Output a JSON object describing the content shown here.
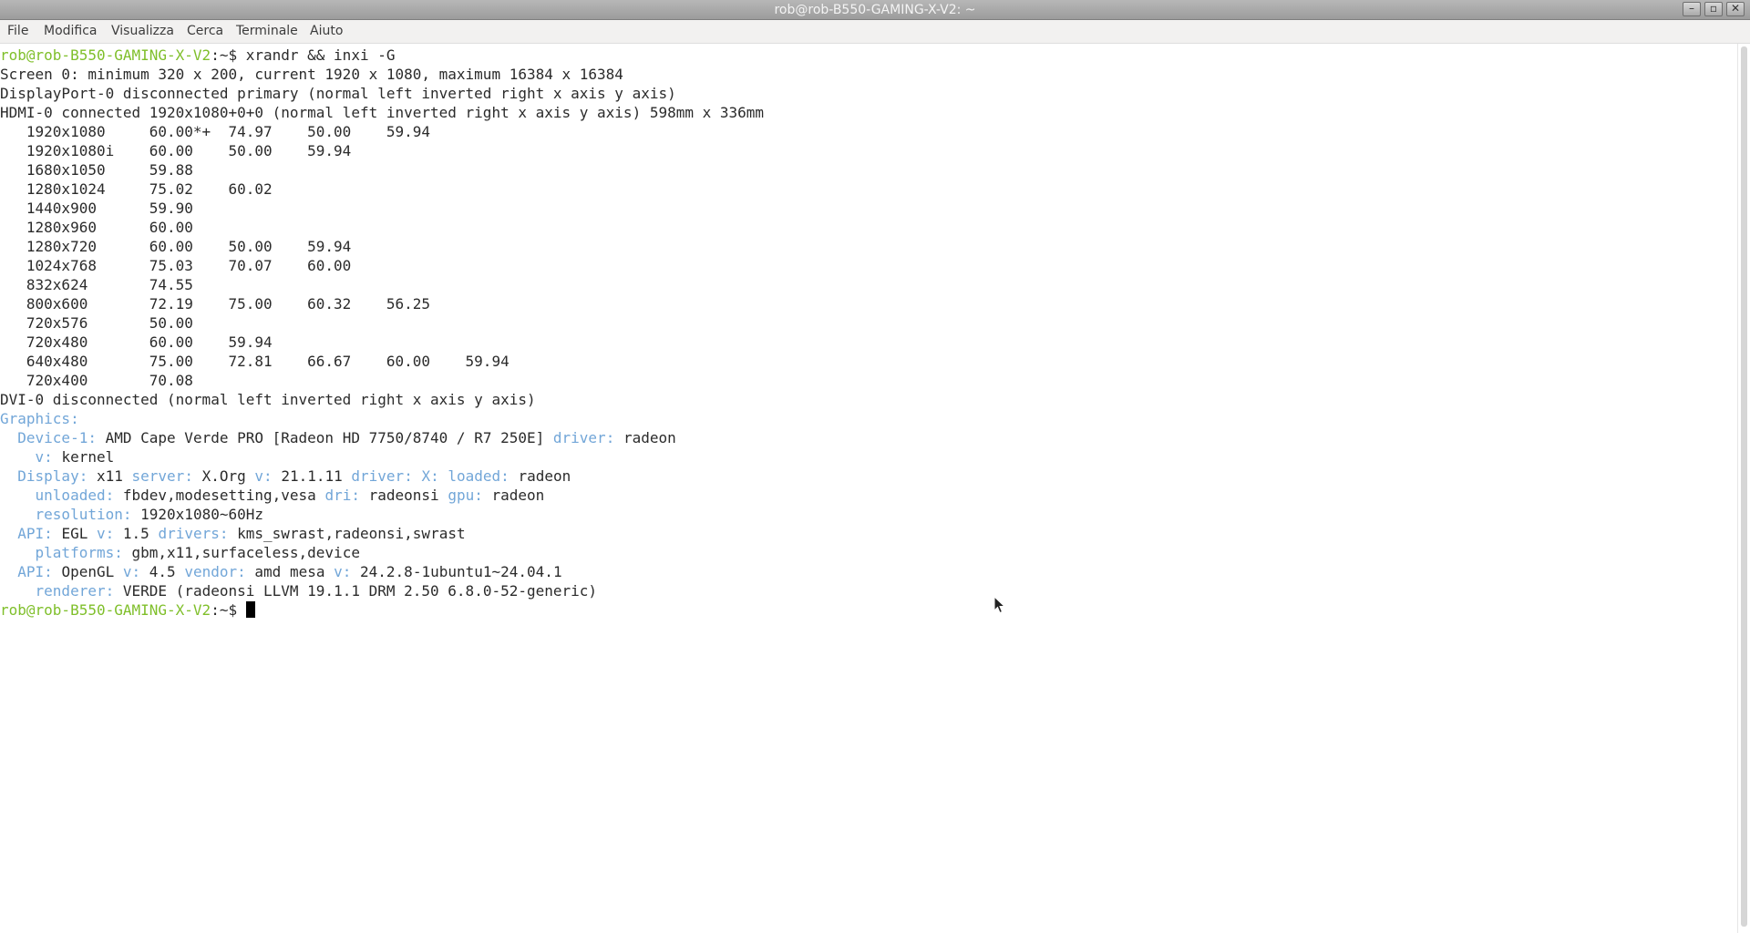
{
  "window": {
    "title": "rob@rob-B550-GAMING-X-V2: ~",
    "controls": [
      "minimize",
      "maximize",
      "close"
    ]
  },
  "menu": [
    "File",
    "Modifica",
    "Visualizza",
    "Cerca",
    "Terminale",
    "Aiuto"
  ],
  "prompt": "rob@rob-B550-GAMING-X-V2",
  "prompt_suffix": ":~$ ",
  "command": "xrandr && inxi -G",
  "xrandr": {
    "screen": "Screen 0: minimum 320 x 200, current 1920 x 1080, maximum 16384 x 16384",
    "dp": "DisplayPort-0 disconnected primary (normal left inverted right x axis y axis)",
    "hdmi": "HDMI-0 connected 1920x1080+0+0 (normal left inverted right x axis y axis) 598mm x 336mm",
    "modes": [
      "   1920x1080     60.00*+  74.97    50.00    59.94",
      "   1920x1080i    60.00    50.00    59.94",
      "   1680x1050     59.88",
      "   1280x1024     75.02    60.02",
      "   1440x900      59.90",
      "   1280x960      60.00",
      "   1280x720      60.00    50.00    59.94",
      "   1024x768      75.03    70.07    60.00",
      "   832x624       74.55",
      "   800x600       72.19    75.00    60.32    56.25",
      "   720x576       50.00",
      "   720x480       60.00    59.94",
      "   640x480       75.00    72.81    66.67    60.00    59.94",
      "   720x400       70.08"
    ],
    "dvi": "DVI-0 disconnected (normal left inverted right x axis y axis)"
  },
  "inxi": [
    {
      "indent": "",
      "parts": [
        {
          "label": "Graphics:"
        }
      ]
    },
    {
      "indent": "  ",
      "parts": [
        {
          "label": "Device-1:",
          "value": "AMD Cape Verde PRO [Radeon HD 7750/8740 / R7 250E]"
        },
        {
          "label": "driver:",
          "value": "radeon"
        }
      ]
    },
    {
      "indent": "    ",
      "parts": [
        {
          "label": "v:",
          "value": "kernel"
        }
      ]
    },
    {
      "indent": "  ",
      "parts": [
        {
          "label": "Display:",
          "value": "x11"
        },
        {
          "label": "server:",
          "value": "X.Org"
        },
        {
          "label": "v:",
          "value": "21.1.11"
        },
        {
          "label": "driver:",
          "value": ""
        },
        {
          "label": "X:",
          "value": ""
        },
        {
          "label": "loaded:",
          "value": "radeon"
        }
      ]
    },
    {
      "indent": "    ",
      "parts": [
        {
          "label": "unloaded:",
          "value": "fbdev,modesetting,vesa"
        },
        {
          "label": "dri:",
          "value": "radeonsi"
        },
        {
          "label": "gpu:",
          "value": "radeon"
        }
      ]
    },
    {
      "indent": "    ",
      "parts": [
        {
          "label": "resolution:",
          "value": "1920x1080~60Hz"
        }
      ]
    },
    {
      "indent": "  ",
      "parts": [
        {
          "label": "API:",
          "value": "EGL"
        },
        {
          "label": "v:",
          "value": "1.5"
        },
        {
          "label": "drivers:",
          "value": "kms_swrast,radeonsi,swrast"
        }
      ]
    },
    {
      "indent": "    ",
      "parts": [
        {
          "label": "platforms:",
          "value": "gbm,x11,surfaceless,device"
        }
      ]
    },
    {
      "indent": "  ",
      "parts": [
        {
          "label": "API:",
          "value": "OpenGL"
        },
        {
          "label": "v:",
          "value": "4.5"
        },
        {
          "label": "vendor:",
          "value": "amd mesa"
        },
        {
          "label": "v:",
          "value": "24.2.8-1ubuntu1~24.04.1"
        }
      ]
    },
    {
      "indent": "    ",
      "parts": [
        {
          "label": "renderer:",
          "value": "VERDE (radeonsi LLVM 19.1.1 DRM 2.50 6.8.0-52-generic)"
        }
      ]
    }
  ]
}
